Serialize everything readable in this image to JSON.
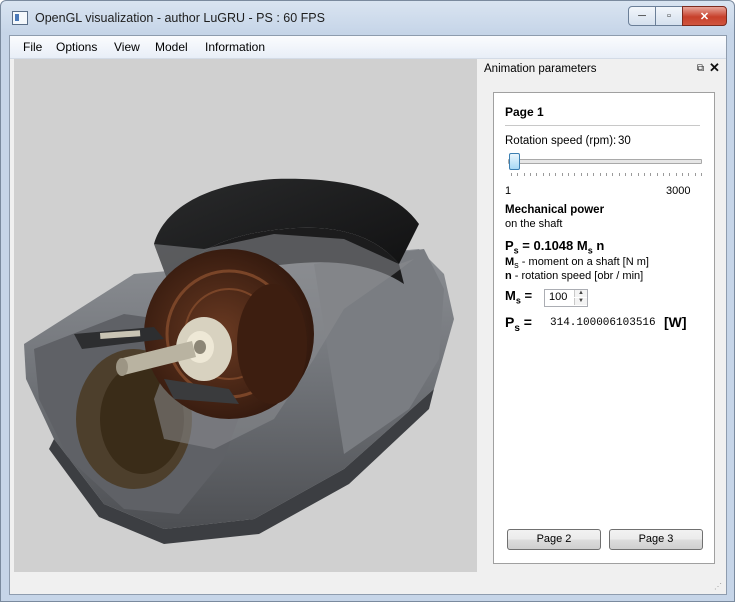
{
  "window": {
    "title": "OpenGL visualization - author LuGRU - PS : 60 FPS",
    "icon": "app-window-icon"
  },
  "caption": {
    "minimize": "─",
    "maximize": "▫",
    "close": "✕"
  },
  "menu": {
    "items": [
      "File",
      "Options",
      "View",
      "Model",
      "Information"
    ]
  },
  "dock": {
    "title": "Animation parameters",
    "float_icon": "⧉",
    "close_icon": "✕",
    "page_title": "Page 1",
    "rotation": {
      "label": "Rotation speed (rpm):",
      "value": "30",
      "min_label": "1",
      "max_label": "3000",
      "min": 1,
      "max": 3000,
      "current": 30
    },
    "mech_power": {
      "title": "Mechanical power",
      "subtitle": "on the shaft"
    },
    "formula": {
      "lhs": "P",
      "lhs_sub": "s",
      "eq": " = 0.1048 M",
      "m_sub": "s",
      "tail": " n"
    },
    "definitions": {
      "m": {
        "sym": "M",
        "sub": "s",
        "text": " - moment on a shaft [N m]"
      },
      "n": {
        "sym": "n",
        "text": " - rotation speed [obr / min]"
      }
    },
    "ms_input": {
      "sym": "M",
      "sub": "s",
      "eq": " =",
      "value": "100",
      "up": "▲",
      "down": "▼"
    },
    "ps_output": {
      "sym": "P",
      "sub": "s",
      "eq": " =",
      "value": "314.100006103516",
      "unit": "[W]"
    },
    "buttons": {
      "page2": "Page 2",
      "page3": "Page 3"
    }
  }
}
